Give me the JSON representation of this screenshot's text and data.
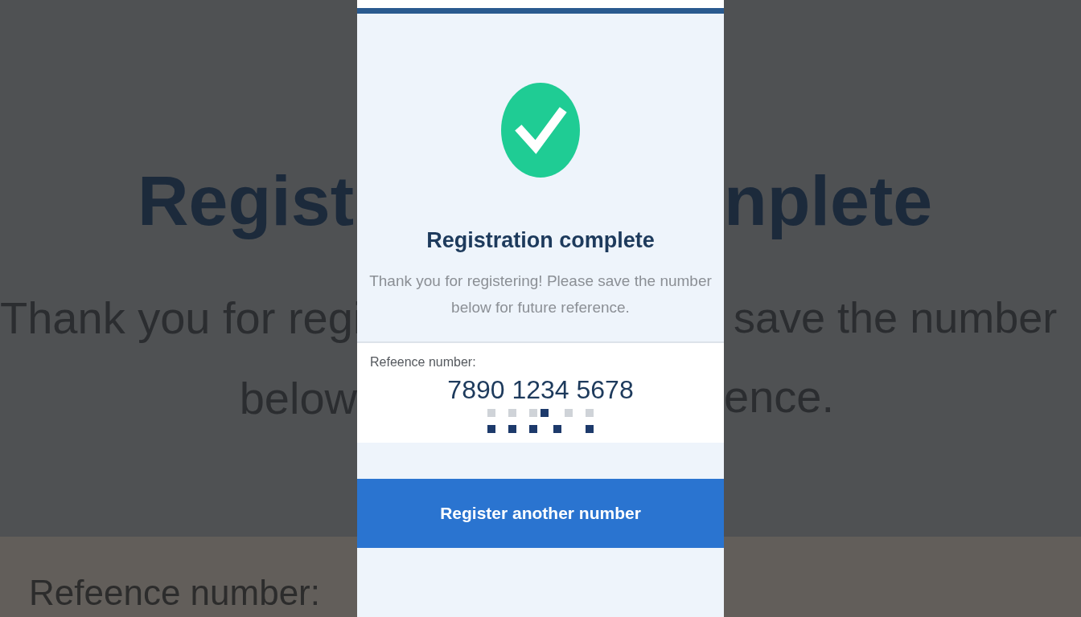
{
  "backdrop": {
    "left": {
      "title": "Regist",
      "message_line_1": "Thank you for regi",
      "message_line_2": "below",
      "label": "Refeence number:"
    },
    "right": {
      "title": "nplete",
      "message_line_1": "save the number",
      "message_line_2": "ence."
    }
  },
  "panel": {
    "title": "Registration complete",
    "message": "Thank you for registering! Please save the number below for future reference.",
    "reference": {
      "label": "Refeence number:",
      "number": "7890 1234 5678"
    },
    "button": "Register another number"
  }
}
